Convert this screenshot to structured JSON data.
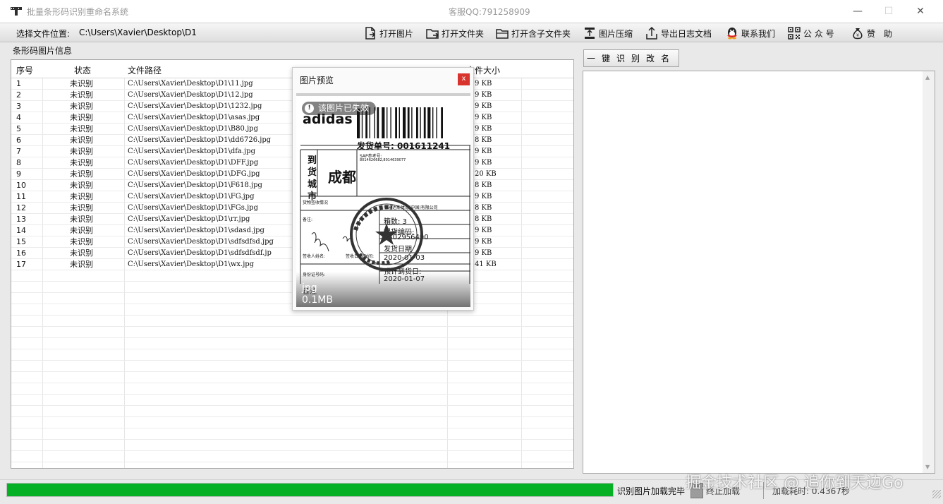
{
  "window": {
    "title": "批量条形码识别重命名系统",
    "service": "客服QQ:791258909",
    "minimize": "—",
    "maximize": "☐",
    "close": "✕"
  },
  "toolbar": {
    "location_label": "选择文件位置:",
    "path_value": "C:\\Users\\Xavier\\Desktop\\D1",
    "buttons": [
      {
        "label": "打开图片",
        "icon": "open-image-icon"
      },
      {
        "label": "打开文件夹",
        "icon": "open-folder-icon"
      },
      {
        "label": "打开含子文件夹",
        "icon": "open-subfolder-icon"
      },
      {
        "label": "图片压缩",
        "icon": "compress-icon"
      },
      {
        "label": "导出日志文档",
        "icon": "export-icon"
      },
      {
        "label": "联系我们",
        "icon": "qq-penguin-icon"
      },
      {
        "label": "公 众 号",
        "icon": "qrcode-icon"
      },
      {
        "label": "赞　助",
        "icon": "money-bag-icon"
      }
    ]
  },
  "left_panel": {
    "group_title": "条形码图片信息",
    "columns": [
      "序号",
      "状态",
      "文件路径",
      "文件大小"
    ],
    "rows": [
      {
        "num": "1",
        "status": "未识别",
        "path": "C:\\Users\\Xavier\\Desktop\\D1\\11.jpg",
        "size": "9 KB"
      },
      {
        "num": "2",
        "status": "未识别",
        "path": "C:\\Users\\Xavier\\Desktop\\D1\\12.jpg",
        "size": "9 KB"
      },
      {
        "num": "3",
        "status": "未识别",
        "path": "C:\\Users\\Xavier\\Desktop\\D1\\1232.jpg",
        "size": "9 KB"
      },
      {
        "num": "4",
        "status": "未识别",
        "path": "C:\\Users\\Xavier\\Desktop\\D1\\asas.jpg",
        "size": "9 KB"
      },
      {
        "num": "5",
        "status": "未识别",
        "path": "C:\\Users\\Xavier\\Desktop\\D1\\B80.jpg",
        "size": "9 KB"
      },
      {
        "num": "6",
        "status": "未识别",
        "path": "C:\\Users\\Xavier\\Desktop\\D1\\dd6726.jpg",
        "size": "8 KB"
      },
      {
        "num": "7",
        "status": "未识别",
        "path": "C:\\Users\\Xavier\\Desktop\\D1\\dfa.jpg",
        "size": "9 KB"
      },
      {
        "num": "8",
        "status": "未识别",
        "path": "C:\\Users\\Xavier\\Desktop\\D1\\DFF.jpg",
        "size": "9 KB"
      },
      {
        "num": "9",
        "status": "未识别",
        "path": "C:\\Users\\Xavier\\Desktop\\D1\\DFG.jpg",
        "size": "20 KB"
      },
      {
        "num": "10",
        "status": "未识别",
        "path": "C:\\Users\\Xavier\\Desktop\\D1\\F618.jpg",
        "size": "8 KB"
      },
      {
        "num": "11",
        "status": "未识别",
        "path": "C:\\Users\\Xavier\\Desktop\\D1\\FG.jpg",
        "size": "9 KB"
      },
      {
        "num": "12",
        "status": "未识别",
        "path": "C:\\Users\\Xavier\\Desktop\\D1\\FGs.jpg",
        "size": "8 KB"
      },
      {
        "num": "13",
        "status": "未识别",
        "path": "C:\\Users\\Xavier\\Desktop\\D1\\rr.jpg",
        "size": "8 KB"
      },
      {
        "num": "14",
        "status": "未识别",
        "path": "C:\\Users\\Xavier\\Desktop\\D1\\sdasd.jpg",
        "size": "9 KB"
      },
      {
        "num": "15",
        "status": "未识别",
        "path": "C:\\Users\\Xavier\\Desktop\\D1\\sdfsdfsd.jpg",
        "size": "9 KB"
      },
      {
        "num": "16",
        "status": "未识别",
        "path": "C:\\Users\\Xavier\\Desktop\\D1\\sdfsdfsdf.jp",
        "size": "9 KB"
      },
      {
        "num": "17",
        "status": "未识别",
        "path": "C:\\Users\\Xavier\\Desktop\\D1\\wx.jpg",
        "size": "41 KB"
      }
    ]
  },
  "right_panel": {
    "rename_button": "一键识别改名"
  },
  "preview": {
    "title": "图片预览",
    "close": "x",
    "badge": "该图片已失效",
    "badge_icon": "!",
    "brand": "adidas",
    "waybill": "发货单号:  001611241",
    "sap": "SAP参考号:",
    "sap_value": "8014626682,8014639077",
    "dest_chars": "到货城市",
    "city": "成都",
    "label_goods": "货物签收情况",
    "label_company": "阿迪达斯体育(中国)有限公司",
    "label_remark": "备注:",
    "label_boxes": "箱数: 3",
    "label_code": "提货编码:",
    "code_value": "0502956490",
    "label_signer": "签收人姓名:",
    "label_sign_date": "签收日期/时间:",
    "label_ship": "发货日期",
    "ship_date": "2020-01-03",
    "label_eta": "预计到货日:",
    "eta_date": "2020-01-07",
    "label_id": "身份证号码:",
    "label_notes": "备注",
    "file_name": "jpg",
    "file_size": "0.1MB"
  },
  "status": {
    "progress_percent": 100,
    "message": "识别图片加载完毕",
    "operation": "终止加载",
    "elapsed": "加载耗时: 0.4367秒",
    "progress_color": "#06b025"
  },
  "watermark": "掘金技术社区 @ 追你到天边Go"
}
